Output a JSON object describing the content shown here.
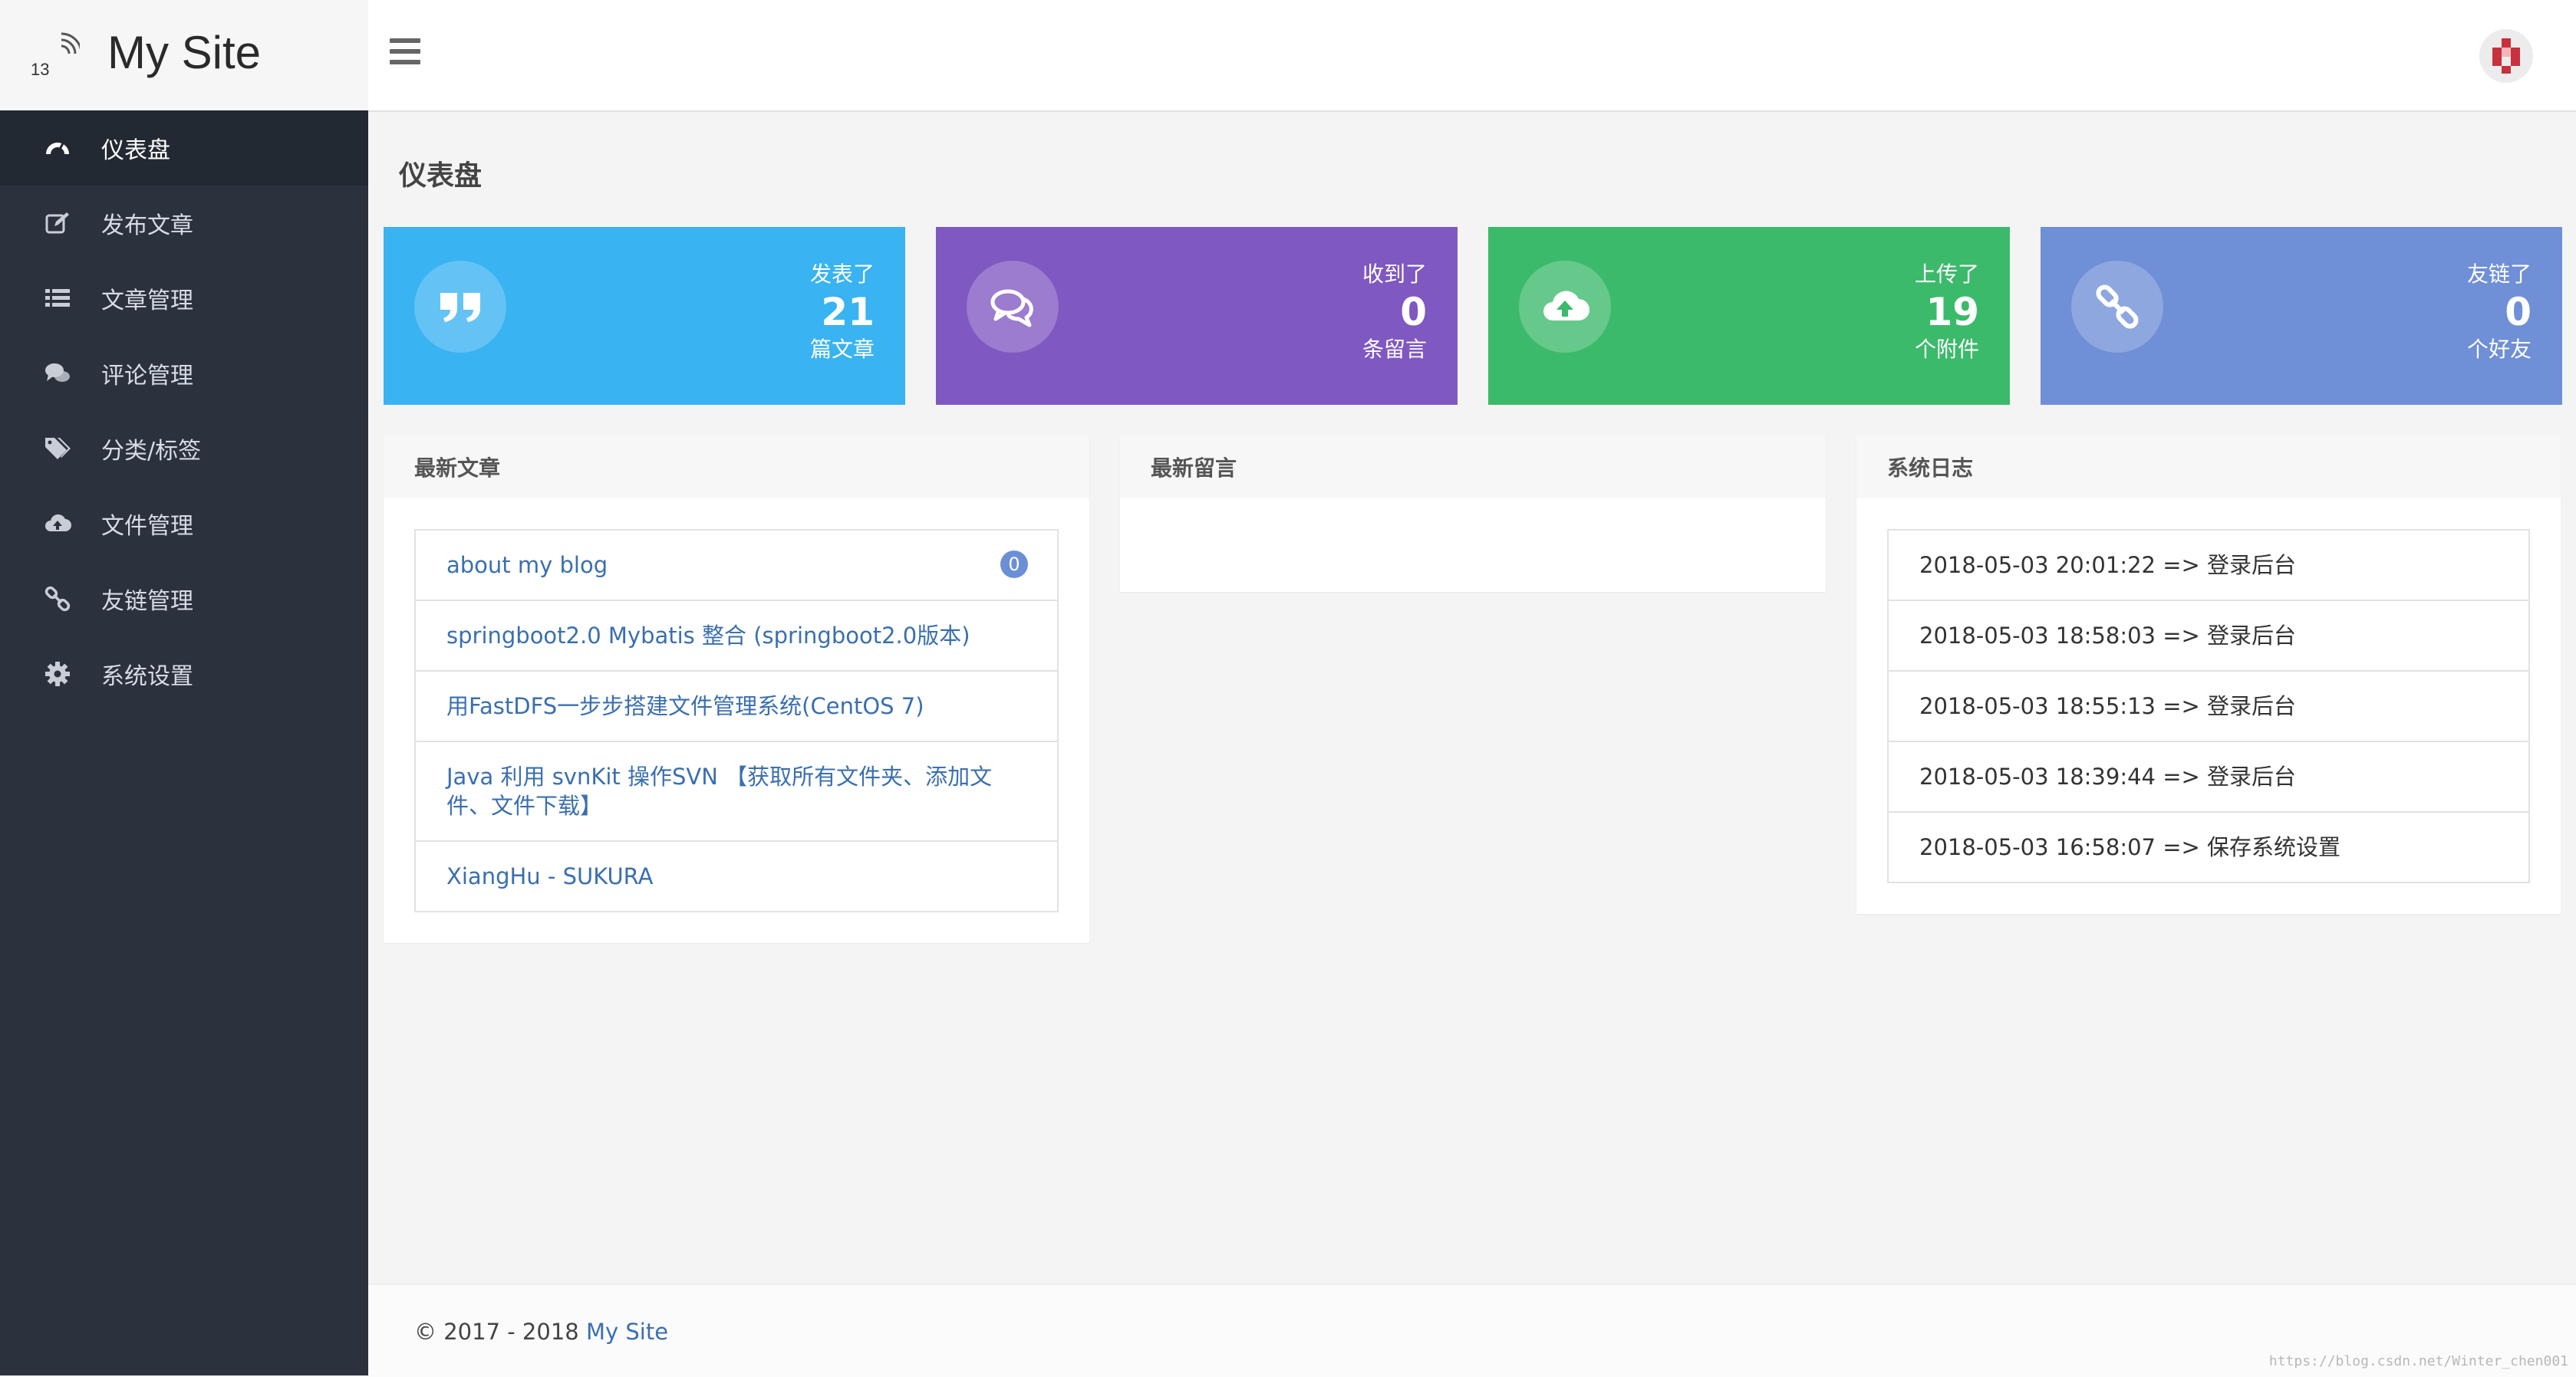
{
  "site": {
    "logo_number": "13",
    "title": "My Site"
  },
  "sidebar": {
    "items": [
      {
        "label": "仪表盘",
        "icon": "dashboard-icon",
        "active": true
      },
      {
        "label": "发布文章",
        "icon": "edit-icon",
        "active": false
      },
      {
        "label": "文章管理",
        "icon": "list-icon",
        "active": false
      },
      {
        "label": "评论管理",
        "icon": "comments-icon",
        "active": false
      },
      {
        "label": "分类/标签",
        "icon": "tags-icon",
        "active": false
      },
      {
        "label": "文件管理",
        "icon": "cloud-upload-icon",
        "active": false
      },
      {
        "label": "友链管理",
        "icon": "link-icon",
        "active": false
      },
      {
        "label": "系统设置",
        "icon": "gear-icon",
        "active": false
      }
    ]
  },
  "main": {
    "title": "仪表盘",
    "stats": [
      {
        "top": "发表了",
        "value": "21",
        "bottom": "篇文章",
        "icon": "quote-icon",
        "color": "#39b3f1"
      },
      {
        "top": "收到了",
        "value": "0",
        "bottom": "条留言",
        "icon": "comments-icon",
        "color": "#7f58c1"
      },
      {
        "top": "上传了",
        "value": "19",
        "bottom": "个附件",
        "icon": "cloud-upload-icon",
        "color": "#3cba6b"
      },
      {
        "top": "友链了",
        "value": "0",
        "bottom": "个好友",
        "icon": "link-icon",
        "color": "#6f8fd6"
      }
    ],
    "latest_posts": {
      "title": "最新文章",
      "items": [
        {
          "text": "about my blog",
          "badge": "0"
        },
        {
          "text": "springboot2.0 Mybatis 整合 (springboot2.0版本)"
        },
        {
          "text": "用FastDFS一步步搭建文件管理系统(CentOS 7)"
        },
        {
          "text": "Java 利用 svnKit 操作SVN 【获取所有文件夹、添加文件、文件下载】"
        },
        {
          "text": "XiangHu - SUKURA"
        }
      ]
    },
    "latest_comments": {
      "title": "最新留言"
    },
    "system_log": {
      "title": "系统日志",
      "items": [
        "2018-05-03 20:01:22 => 登录后台",
        "2018-05-03 18:58:03 => 登录后台",
        "2018-05-03 18:55:13 => 登录后台",
        "2018-05-03 18:39:44 => 登录后台",
        "2018-05-03 16:58:07 => 保存系统设置"
      ]
    }
  },
  "footer": {
    "prefix": "© 2017 - 2018 ",
    "site_link": "My Site"
  },
  "watermark": "https://blog.csdn.net/Winter_chen001"
}
